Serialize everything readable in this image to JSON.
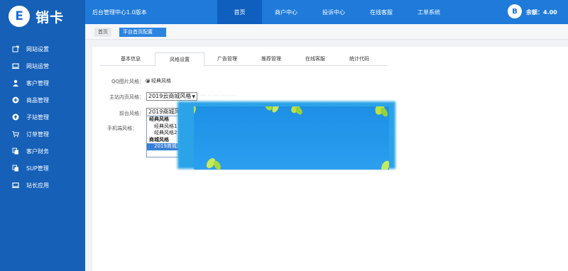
{
  "brand": {
    "logo_letter": "E",
    "logo_text": "销卡"
  },
  "sidebar": {
    "items": [
      {
        "label": "网站设置",
        "icon": "edit-box-icon"
      },
      {
        "label": "网站运营",
        "icon": "monitor-icon"
      },
      {
        "label": "客户管理",
        "icon": "user-icon"
      },
      {
        "label": "商品管理",
        "icon": "plus-circle-icon"
      },
      {
        "label": "子站管理",
        "icon": "pin-icon"
      },
      {
        "label": "订单管理",
        "icon": "cart-icon"
      },
      {
        "label": "客户财务",
        "icon": "copy-icon"
      },
      {
        "label": "SUP管理",
        "icon": "copy-icon"
      },
      {
        "label": "站长应用",
        "icon": "monitor-icon"
      }
    ]
  },
  "header": {
    "app_title": "后台管理中心1.0版本",
    "tabs": [
      {
        "label": "首页",
        "active": true
      },
      {
        "label": "商户中心",
        "active": false
      },
      {
        "label": "投诉中心",
        "active": false
      },
      {
        "label": "在线客服",
        "active": false
      },
      {
        "label": "工单系统",
        "active": false
      }
    ],
    "avatar_letter": "B",
    "balance": "余额：4.00"
  },
  "breadcrumb": {
    "home": "首页",
    "current": "平台首页配置"
  },
  "tabs": [
    {
      "label": "基本信息",
      "active": false
    },
    {
      "label": "风格设置",
      "active": true
    },
    {
      "label": "广告管理",
      "active": false
    },
    {
      "label": "推荐管理",
      "active": false
    },
    {
      "label": "在线客服",
      "active": false
    },
    {
      "label": "统计代码",
      "active": false
    }
  ],
  "form": {
    "qq_label": "QQ图片风格：",
    "qq_value": "经典风格",
    "main_label": "主站内页风格：",
    "main_value": "2019云商城风格",
    "front_label": "前台风格：",
    "front_value": "2019商城风格",
    "mobile_label": "手机端风格："
  },
  "dropdown": {
    "options": [
      {
        "label": "经典风格",
        "kind": "group"
      },
      {
        "label": "经典风格1",
        "kind": "child"
      },
      {
        "label": "经典风格2",
        "kind": "child"
      },
      {
        "label": "商城风格",
        "kind": "group"
      },
      {
        "label": "2019商城风格",
        "kind": "selected"
      }
    ]
  },
  "colors": {
    "sidebar": "#1660b8",
    "topbar": "#1f7ad9",
    "nav_active": "#0f5fbf",
    "accent": "#2b84e0",
    "preview": "#1d8fe6"
  }
}
